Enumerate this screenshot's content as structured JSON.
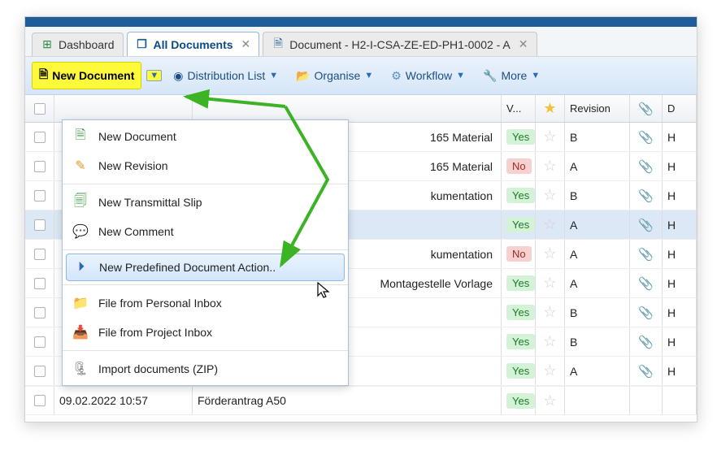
{
  "tabs": [
    {
      "label": "Dashboard",
      "icon": "⊞"
    },
    {
      "label": "All Documents",
      "icon": "📄",
      "active": true,
      "closable": true
    },
    {
      "label": "Document - H2-I-CSA-ZE-ED-PH1-0002 - A",
      "icon": "📄",
      "closable": true
    }
  ],
  "toolbar": {
    "new_document": "New Document",
    "distribution": "Distribution List",
    "organise": "Organise",
    "workflow": "Workflow",
    "more": "More"
  },
  "columns": {
    "v": "V...",
    "rev": "Revision",
    "d": "D"
  },
  "rows": [
    {
      "desc_trunc": "165 Material",
      "yn": "Yes",
      "rev": "B",
      "d": "H"
    },
    {
      "desc_trunc": "165 Material",
      "yn": "No",
      "rev": "A",
      "d": "H"
    },
    {
      "desc_trunc": "kumentation",
      "yn": "Yes",
      "rev": "B",
      "d": "H"
    },
    {
      "desc_trunc": "",
      "yn": "Yes",
      "rev": "A",
      "d": "H",
      "selected": true
    },
    {
      "desc_trunc": "kumentation",
      "yn": "No",
      "rev": "A",
      "d": "H"
    },
    {
      "desc_trunc": "Montagestelle Vorlage",
      "yn": "Yes",
      "rev": "A",
      "d": "H"
    },
    {
      "desc_trunc": "",
      "yn": "Yes",
      "rev": "B",
      "d": "H"
    },
    {
      "desc_trunc": "",
      "yn": "Yes",
      "rev": "B",
      "d": "H"
    },
    {
      "desc_trunc": "",
      "yn": "Yes",
      "rev": "A",
      "d": "H"
    }
  ],
  "bottom_row": {
    "date": "09.02.2022 10:57",
    "desc": "Förderantrag A50",
    "yn": "Yes"
  },
  "dropdown": {
    "new_document": "New Document",
    "new_revision": "New Revision",
    "new_transmittal": "New Transmittal Slip",
    "new_comment": "New Comment",
    "predefined": "New Predefined Document Action..",
    "personal_inbox": "File from Personal Inbox",
    "project_inbox": "File from Project Inbox",
    "import_zip": "Import documents (ZIP)"
  },
  "arrow_color": "#3bb324"
}
